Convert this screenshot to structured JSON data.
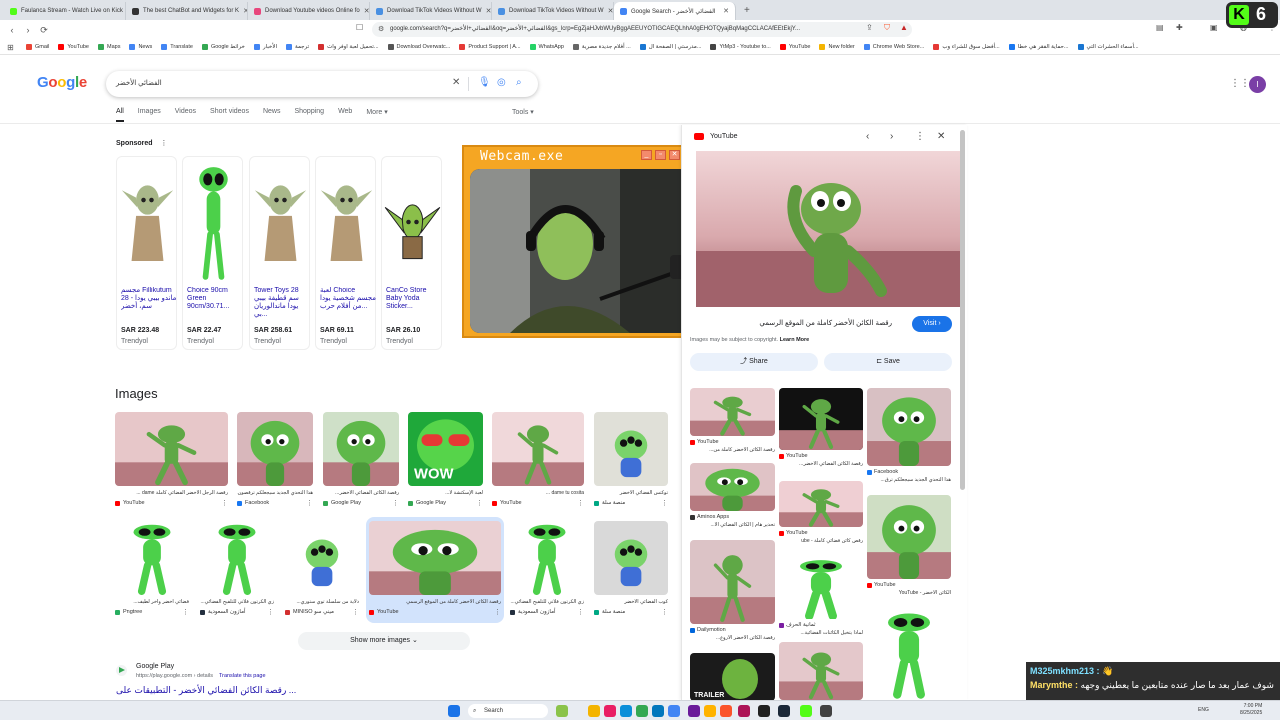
{
  "tabs": [
    {
      "title": "Faulanca Stream - Watch Live on Kick",
      "color": "#53fc18"
    },
    {
      "title": "The best ChatBot and Widgets for K",
      "color": "#333333"
    },
    {
      "title": "Download Youtube videos Online fo",
      "color": "#e8467c"
    },
    {
      "title": "Download TikTok Videos Without W",
      "color": "#4a90e2"
    },
    {
      "title": "Download TikTok Videos Without W",
      "color": "#4a90e2"
    },
    {
      "title": "Google Search - الفضائي الأخضر",
      "color": "#4285f4",
      "active": true
    }
  ],
  "omnibox": {
    "url": "google.com/search?q=الفضائي+الأخضر&oq=الفضائي+الأخضر&gs_lcrp=EgZjaHJvbWUyBggAEEUYOTIGCAEQLhhA0gEHOTQyajBqMagCCLACAfEEtEkjY..."
  },
  "bookmarks": [
    {
      "label": "Gmail",
      "color": "#ea4335"
    },
    {
      "label": "YouTube",
      "color": "#ff0000"
    },
    {
      "label": "Maps",
      "color": "#34a853"
    },
    {
      "label": "News",
      "color": "#4285f4"
    },
    {
      "label": "Translate",
      "color": "#4285f4"
    },
    {
      "label": "Google خرائط",
      "color": "#34a853"
    },
    {
      "label": "الأخبار",
      "color": "#4285f4"
    },
    {
      "label": "ترجمة",
      "color": "#4285f4"
    },
    {
      "label": "تحميل لعبة اوفر وات...",
      "color": "#d32f2f"
    },
    {
      "label": "Download Overwatc...",
      "color": "#555555"
    },
    {
      "label": "Product Support | A...",
      "color": "#e53935"
    },
    {
      "label": "WhatsApp",
      "color": "#25d366"
    },
    {
      "label": "أفلام جديدة مصرية ...",
      "color": "#666666"
    },
    {
      "label": "مدرستي | الصفحة ال...",
      "color": "#1976d2"
    },
    {
      "label": "YtMp3 - Youtube to...",
      "color": "#444444"
    },
    {
      "label": "YouTube",
      "color": "#ff0000"
    },
    {
      "label": "New folder",
      "color": "#f4b400"
    },
    {
      "label": "Chrome Web Store...",
      "color": "#4285f4"
    },
    {
      "label": "أفضل سوق للشراء وب...",
      "color": "#e53935"
    },
    {
      "label": "حماية الفقر هي خطا...",
      "color": "#1877f2"
    },
    {
      "label": "أسماء الحشرات التي...",
      "color": "#1976d2"
    }
  ],
  "google": {
    "logo": "Google",
    "query": "الفضائي الأخضر",
    "avatar_letter": "I"
  },
  "search_tabs": [
    "All",
    "Images",
    "Videos",
    "Short videos",
    "News",
    "Shopping",
    "Web",
    "More"
  ],
  "tools_label": "Tools",
  "sponsored_label": "Sponsored",
  "products": [
    {
      "title": "مجسم Fillikutum ماندو بيبي يودا - 28 سم، أخضر",
      "price": "SAR 223.48",
      "store": "Trendyol",
      "kind": "yoda"
    },
    {
      "title": "Choice 90cm Green 90cm/30.71...",
      "price": "SAR 22.47",
      "store": "Trendyol",
      "kind": "alien"
    },
    {
      "title": "Tower Toys 28 سم قطيفة بيبي يودا ماندالوريان بي...",
      "price": "SAR 258.61",
      "store": "Trendyol",
      "kind": "yoda"
    },
    {
      "title": "لعبة Choice مجسم شخصية يودا من أفلام حرب...",
      "price": "SAR 69.11",
      "store": "Trendyol",
      "kind": "yoda"
    },
    {
      "title": "CanCo Store Baby Yoda Sticker...",
      "price": "SAR 26.10",
      "store": "Trendyol",
      "kind": "sticker"
    }
  ],
  "images_heading": "Images",
  "image_results": [
    {
      "caption": "رقصة الرجل الأخضر الفضائي كاملة dame ...",
      "source": "YouTube",
      "src_color": "#ff0000"
    },
    {
      "caption": "هذا التحدي الجديد سيجعلكم ترقصون...",
      "source": "Facebook",
      "src_color": "#1877f2"
    },
    {
      "caption": "رقصة الكائن الفضائي الأخضر...",
      "source": "Google Play",
      "src_color": "#34a853"
    },
    {
      "caption": "لعبة الإسكتشة لا...",
      "source": "Google Play",
      "src_color": "#34a853"
    },
    {
      "caption": "dame tu cosita ...",
      "source": "YouTube",
      "src_color": "#ff0000"
    },
    {
      "caption": "توكتس الفضائي الأخضر",
      "source": "منصة سلة",
      "src_color": "#00a884"
    },
    {
      "caption": "فضائي أخضر وآخر لطيف...",
      "source": "Pngtree",
      "src_color": "#27ae60"
    },
    {
      "caption": "زي الكرتون فلاتي للتلفيح الفضائي...",
      "source": "أمازون السعودية",
      "src_color": "#232f3e"
    },
    {
      "caption": "دلاية من سلسلة توي ستوري...",
      "source": "MINISO ميني سو",
      "src_color": "#d32f2f"
    },
    {
      "caption": "رقصة الكائن الأخضر كاملة من الموقع الرسمي",
      "source": "YouTube",
      "src_color": "#ff0000"
    },
    {
      "caption": "زي الكرتون فلاتي للتلفيح الفضائي...",
      "source": "أمازون السعودية",
      "src_color": "#232f3e"
    },
    {
      "caption": "كوب الفضائي الأخضر",
      "source": "منصة سلة",
      "src_color": "#00a884"
    }
  ],
  "show_more": "Show more images",
  "result": {
    "source": "Google Play",
    "url": "https://play.google.com › details",
    "translate": "Translate this page",
    "title": "رقصة الكائن الفضائي الأخضر - التطبيقات على ..."
  },
  "webcam": {
    "title": "Webcam.exe"
  },
  "panel": {
    "source": "YouTube",
    "title": "رقصة الكائن الأخضر كاملة من الموقع الرسمي",
    "visit": "Visit",
    "copyright": "Images may be subject to copyright.",
    "learn_more": "Learn More",
    "share": "Share",
    "save": "Save",
    "related": [
      {
        "source": "YouTube",
        "caption": "رقصة الكائن الأخضر كاملة من...",
        "src_color": "#ff0000"
      },
      {
        "source": "YouTube",
        "caption": "رقصة الكائن الفضائي الأخضر...",
        "src_color": "#ff0000"
      },
      {
        "source": "Facebook",
        "caption": "هذا التحدي الجديد سيجعلكم ترق...",
        "src_color": "#1877f2"
      },
      {
        "source": "Aminos Apps",
        "caption": "تحذير هام | الكائن الفضائي الأ...",
        "src_color": "#333333"
      },
      {
        "source": "YouTube",
        "caption": "رقص كائن فضائي كاملة - ube",
        "src_color": "#ff0000"
      },
      {
        "source": "YouTube",
        "caption": "الكائن الأخضر - YouTube",
        "src_color": "#ff0000"
      },
      {
        "source": "Dailymotion",
        "caption": "رقصة الكائن الأخضر الأروع...",
        "src_color": "#0066dc"
      },
      {
        "source": "ثمانية الحرف",
        "caption": "لماذا يتخيل الكائنات الفضائية...",
        "src_color": "#7b1fa2"
      }
    ]
  },
  "kick": {
    "count": "6"
  },
  "chat": [
    {
      "user": "M325mkhm213 :",
      "text": "👋"
    },
    {
      "user": "Marymthe :",
      "text": "شوف عمار بعد ما صار عنده متابعين ما يعطيني وجهه"
    }
  ],
  "taskbar": {
    "search": "Search",
    "lang": "ENG",
    "time": "7:00 PM",
    "date": "8/25/2025"
  }
}
